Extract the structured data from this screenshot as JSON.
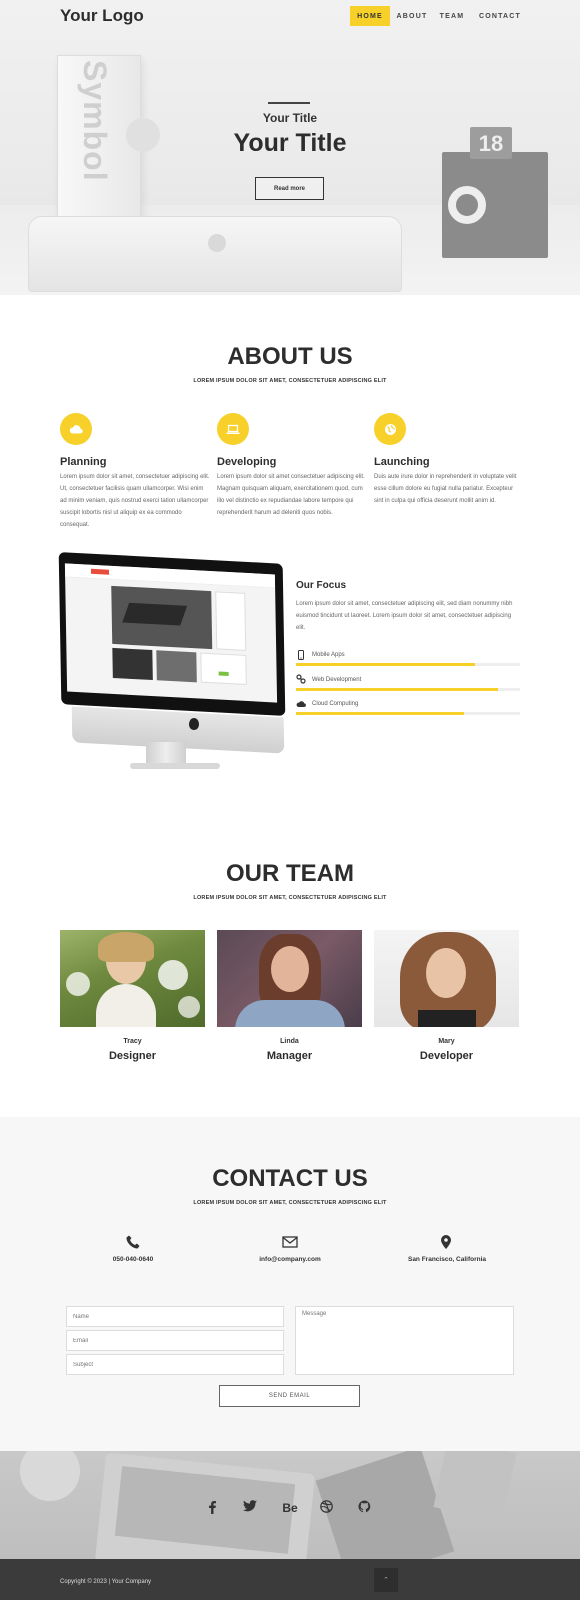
{
  "header": {
    "logo": "Your Logo",
    "nav": [
      "HOME",
      "ABOUT",
      "TEAM",
      "CONTACT"
    ],
    "active_index": 0
  },
  "hero": {
    "subtitle": "Your Title",
    "title": "Your Title",
    "button": "Read more",
    "book_text": "Symbol",
    "calendar_day": "18"
  },
  "about": {
    "title": "ABOUT US",
    "subtitle": "LOREM IPSUM DOLOR SIT AMET, CONSECTETUER ADIPISCING ELIT",
    "features": [
      {
        "icon": "cloud-icon",
        "title": "Planning",
        "text": "Lorem ipsum dolor sit amet, consectetuer adipiscing elit. Ut, consectetuer facilisis quam ullamcorper. Wisi enim ad minim veniam, quis nostrud exerci tation ullamcorper suscipit lobortis nisl ut aliquip ex ea commodo consequat."
      },
      {
        "icon": "laptop-icon",
        "title": "Developing",
        "text": "Lorem ipsum dolor sit amet consectetuer adipiscing elit. Magnam quisquam aliquam, exercitationem quod, cum illo vel distinctio ex repudiandae labore tempore qui reprehenderit harum ad deleniti quos nobis."
      },
      {
        "icon": "globe-icon",
        "title": "Launching",
        "text": "Duis aute irure dolor in reprehenderit in voluptate velit esse cillum dolore eu fugiat nulla pariatur. Excepteur sint in culpa qui officia deserunt mollit anim id."
      }
    ]
  },
  "focus": {
    "title": "Our Focus",
    "text": "Lorem ipsum dolor sit amet, consectetuer adipiscing elit, sed diam nonummy nibh euismod tincidunt ut laoreet. Lorem ipsum dolor sit amet, consectetuer adipiscing elit.",
    "skills": [
      {
        "icon": "mobile-icon",
        "label": "Mobile Apps",
        "level": 0.8
      },
      {
        "icon": "link-icon",
        "label": "Web Development",
        "level": 0.9
      },
      {
        "icon": "cloud-icon",
        "label": "Cloud Computing",
        "level": 0.75
      }
    ]
  },
  "team": {
    "title": "OUR TEAM",
    "subtitle": "LOREM IPSUM DOLOR SIT AMET, CONSECTETUER ADIPISCING ELIT",
    "members": [
      {
        "name": "Tracy",
        "role": "Designer"
      },
      {
        "name": "Linda",
        "role": "Manager"
      },
      {
        "name": "Mary",
        "role": "Developer"
      }
    ]
  },
  "contact": {
    "title": "CONTACT US",
    "subtitle": "LOREM IPSUM DOLOR SIT AMET, CONSECTETUER ADIPISCING ELIT",
    "items": [
      {
        "icon": "phone-icon",
        "label": "050-040-0640"
      },
      {
        "icon": "envelope-icon",
        "label": "info@company.com"
      },
      {
        "icon": "map-pin-icon",
        "label": "San Francisco, California"
      }
    ],
    "form": {
      "name_placeholder": "Name",
      "email_placeholder": "Email",
      "subject_placeholder": "Subject",
      "message_placeholder": "Message",
      "send_label": "SEND EMAIL"
    }
  },
  "footer": {
    "social": [
      "facebook-icon",
      "twitter-icon",
      "behance-icon",
      "dribbble-icon",
      "github-icon"
    ],
    "behance_text": "Be",
    "copyright": "Copyright © 2023 | Your Company",
    "to_top": "⌃"
  },
  "colors": {
    "accent": "#f7d12a",
    "dark": "#2d2d2d",
    "footer_bar": "#3b3b3b"
  }
}
